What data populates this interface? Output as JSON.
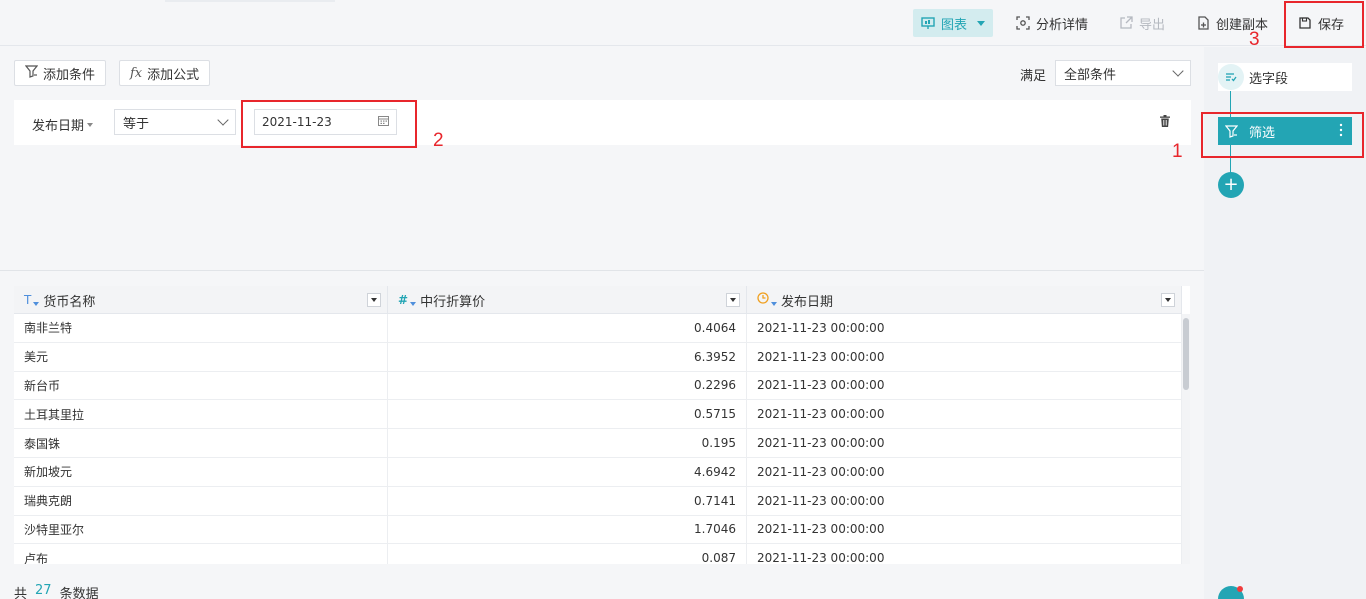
{
  "toolbar": {
    "chart_label": "图表",
    "analysis_label": "分析详情",
    "export_label": "导出",
    "copy_label": "创建副本",
    "save_label": "保存"
  },
  "filter": {
    "add_condition_label": "添加条件",
    "add_formula_label": "添加公式",
    "satisfy_label": "满足",
    "satisfy_value": "全部条件",
    "condition": {
      "field": "发布日期",
      "operator": "等于",
      "value": "2021-11-23"
    }
  },
  "steps": {
    "select_fields": "选字段",
    "filter": "筛选",
    "add": "+"
  },
  "annotations": {
    "n1": "1",
    "n2": "2",
    "n3": "3"
  },
  "table": {
    "columns": [
      {
        "type_icon": "T",
        "label": "货币名称"
      },
      {
        "type_icon": "#",
        "label": "中行折算价"
      },
      {
        "type_icon": "clock",
        "label": "发布日期"
      }
    ],
    "rows": [
      [
        "南非兰特",
        "0.4064",
        "2021-11-23 00:00:00"
      ],
      [
        "美元",
        "6.3952",
        "2021-11-23 00:00:00"
      ],
      [
        "新台币",
        "0.2296",
        "2021-11-23 00:00:00"
      ],
      [
        "土耳其里拉",
        "0.5715",
        "2021-11-23 00:00:00"
      ],
      [
        "泰国铢",
        "0.195",
        "2021-11-23 00:00:00"
      ],
      [
        "新加坡元",
        "4.6942",
        "2021-11-23 00:00:00"
      ],
      [
        "瑞典克朗",
        "0.7141",
        "2021-11-23 00:00:00"
      ],
      [
        "沙特里亚尔",
        "1.7046",
        "2021-11-23 00:00:00"
      ],
      [
        "卢布",
        "0.087",
        "2021-11-23 00:00:00"
      ]
    ]
  },
  "footer": {
    "prefix": "共",
    "count": "27",
    "suffix": "条数据"
  },
  "colors": {
    "accent": "#23a5b4",
    "annotation": "#e8262c"
  }
}
